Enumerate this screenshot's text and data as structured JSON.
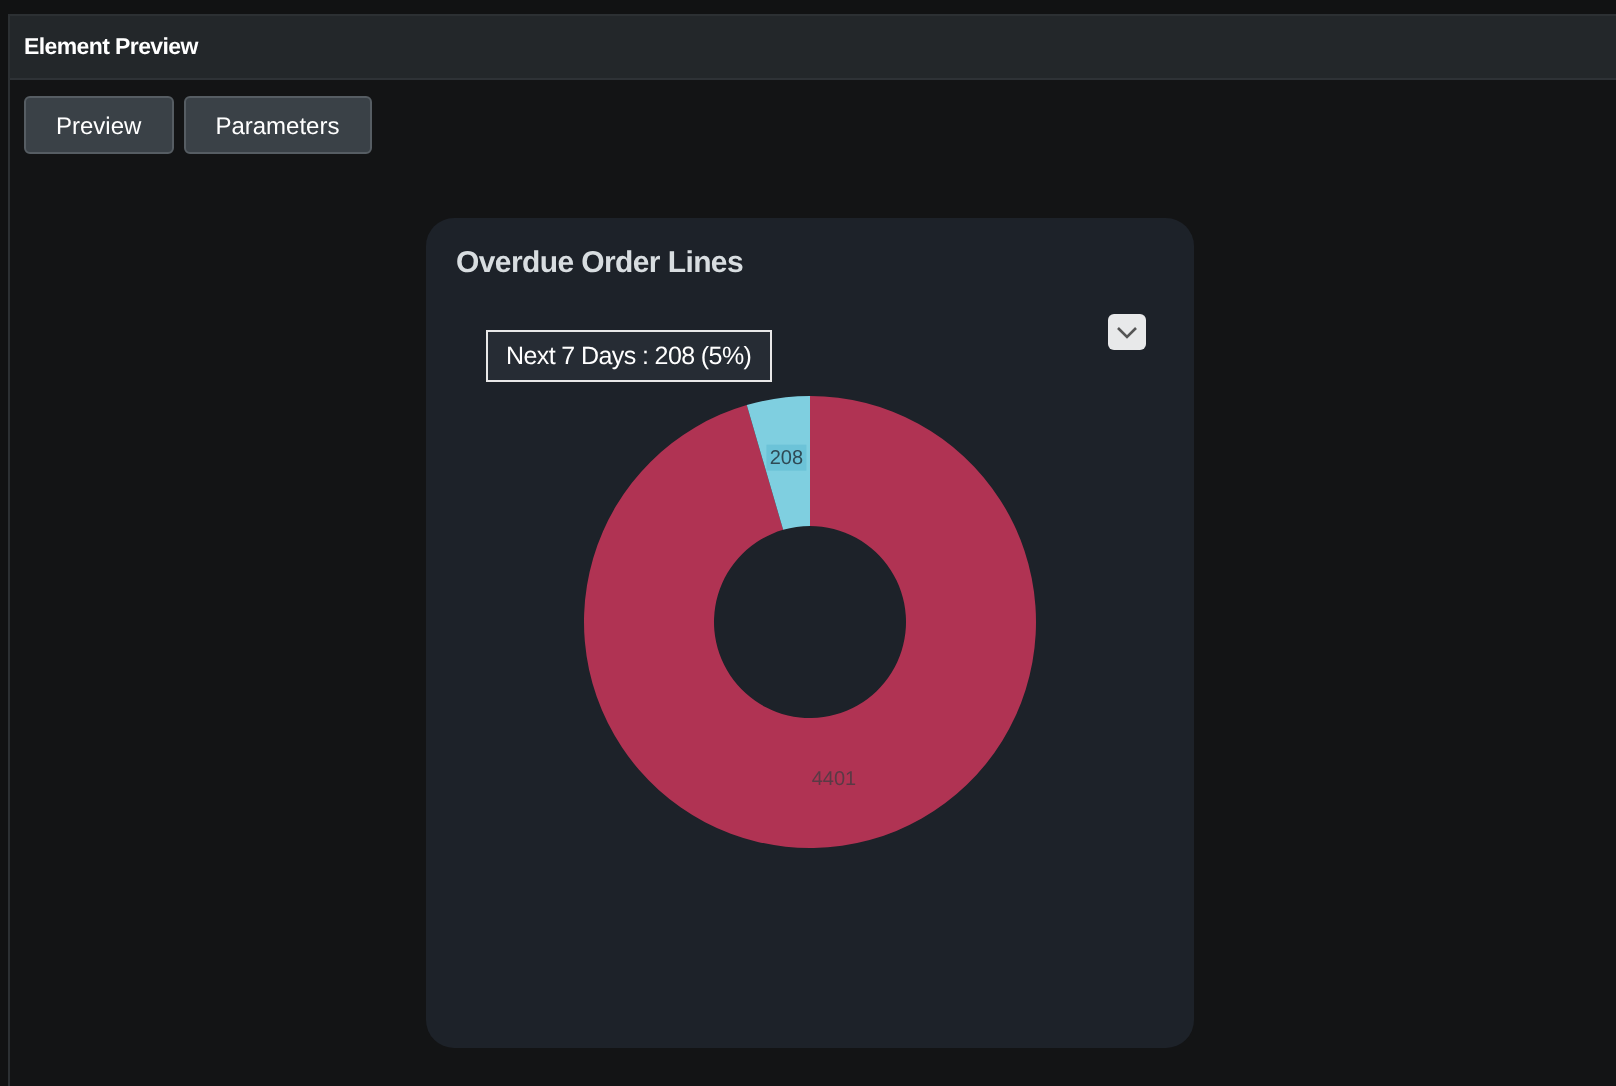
{
  "panel": {
    "title": "Element Preview"
  },
  "buttons": [
    {
      "label": "Preview"
    },
    {
      "label": "Parameters"
    }
  ],
  "card": {
    "title": "Overdue Order Lines",
    "tooltip": {
      "text": "Next 7 Days : 208 (5%)"
    },
    "chart_data": {
      "type": "donut",
      "values": [
        4401,
        208
      ],
      "colors": [
        "#b03353",
        "#7fcfe0"
      ],
      "data_labels": true
    }
  }
}
